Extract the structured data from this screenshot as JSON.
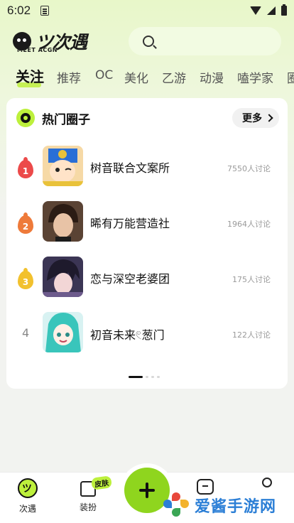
{
  "status": {
    "time": "6:02"
  },
  "header": {
    "logo_text": "ツ次遇",
    "logo_sub": "MEET ACGN",
    "search_placeholder": ""
  },
  "tabs": [
    {
      "label": "关注",
      "active": true
    },
    {
      "label": "推荐",
      "active": false
    },
    {
      "label": "OC",
      "active": false
    },
    {
      "label": "美化",
      "active": false
    },
    {
      "label": "乙游",
      "active": false
    },
    {
      "label": "动漫",
      "active": false
    },
    {
      "label": "嗑学家",
      "active": false
    },
    {
      "label": "圈",
      "active": false
    }
  ],
  "hot_circles": {
    "title": "热门圈子",
    "more_label": "更多",
    "items": [
      {
        "rank": "1",
        "name": "树音联合文案所",
        "count": "7550人讨论",
        "rank_color": "#ec4a4a"
      },
      {
        "rank": "2",
        "name": "晞有万能营造社",
        "count": "1964人讨论",
        "rank_color": "#ee7a3a"
      },
      {
        "rank": "3",
        "name": "恋与深空老婆团",
        "count": "175人讨论",
        "rank_color": "#f2c12e"
      },
      {
        "rank": "4",
        "name": "初音未来𓏲葱门",
        "count": "122人讨论",
        "rank_color": "#888888"
      }
    ]
  },
  "bottom_nav": {
    "home_label": "次遇",
    "dress_label": "装扮",
    "skin_badge": "皮肤"
  },
  "watermark": {
    "text": "爱酱手游网"
  },
  "colors": {
    "accent": "#bdf03c",
    "fab": "#8fd51e"
  }
}
